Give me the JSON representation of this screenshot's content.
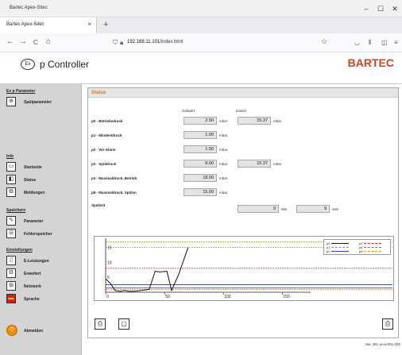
{
  "window": {
    "title": "Bartec Apex-Sitec"
  },
  "tab": {
    "label": "Bartec Apex-Sitec",
    "close": "×",
    "new": "+"
  },
  "nav": {
    "back": "←",
    "forward": "→",
    "reload": "C",
    "home": "⌂",
    "url_host": "192.168.11.101",
    "url_path": "/index.html"
  },
  "header": {
    "logo": "Ex",
    "title": "p Controller",
    "brand": "BARTEC"
  },
  "sidebar": {
    "sec_ex": "Ex p Parameter",
    "spuel": "Spülparameter",
    "sec_info": "Info",
    "startseite": "Startseite",
    "status": "Status",
    "meldungen": "Meldungen",
    "sec_speichern": "Speichern",
    "parameter": "Parameter",
    "fehlerspeicher": "Fehlerspeicher",
    "sec_einstellungen": "Einstellungen",
    "e_leistungen": "E-Leistungen",
    "erweitert": "Erweitert",
    "netzwerk": "Netzwerk",
    "sprache": "Sprache",
    "abmelden": "Abmelden"
  },
  "status": {
    "title": "Status",
    "col_soll": "Sollwert",
    "col_ist": "Istwert",
    "rows": [
      {
        "label": "p0 - Betriebsdruck",
        "soll": "2.50",
        "unit": "mbar",
        "ist": "15.37",
        "ist_unit": "mbar"
      },
      {
        "label": "p1 - Mindestdruck",
        "soll": "1.00",
        "unit": "mbar"
      },
      {
        "label": "p2 - Vor-Alarm",
        "soll": "1.50",
        "unit": "mbar"
      },
      {
        "label": "p3 - Spüldruck",
        "soll": "8.00",
        "unit": "mbar",
        "ist": "15.37",
        "ist_unit": "mbar"
      },
      {
        "label": "p4 - Maximaldruck, Betrieb",
        "soll": "18.00",
        "unit": "mbar"
      },
      {
        "label": "p5 - Maximaldruck, Spülen",
        "soll": "15.00",
        "unit": "mbar"
      }
    ],
    "spuelzeit_label": "Spülzeit",
    "spuelzeit_min": "0",
    "spuelzeit_min_unit": "Min",
    "spuelzeit_sek": "9",
    "spuelzeit_sek_unit": "Sek"
  },
  "chart_data": {
    "type": "line",
    "x_ticks": [
      "0",
      "50",
      "100",
      "150"
    ],
    "y_ticks": [
      "5",
      "10",
      "15"
    ],
    "xlim": [
      0,
      170
    ],
    "ylim": [
      0,
      17
    ],
    "legend": [
      "p0",
      "p1",
      "p2",
      "p3",
      "p4",
      "p5"
    ],
    "series_colors": {
      "p0": "#1a1a1a",
      "p1": "#e07a00",
      "p2": "#2b3fd6",
      "p3": "#cc2222",
      "p4": "#7a8f00",
      "p5": "#d4a500"
    },
    "pressure_line": {
      "x": [
        0,
        4,
        8,
        12,
        16,
        20,
        26,
        34,
        37,
        42,
        46,
        52,
        56,
        62,
        70
      ],
      "y": [
        4.5,
        3.0,
        0.6,
        0.3,
        0.6,
        0.3,
        0.4,
        0.8,
        1.0,
        7.0,
        6.8,
        7.0,
        0.6,
        6.0,
        15.0
      ]
    },
    "thresholds": {
      "p0": 2.5,
      "p1": 1.0,
      "p2": 1.5,
      "p3": 8.0,
      "p4": 18.0,
      "p5": 15.0
    }
  },
  "footer": {
    "version": "Hw. 451-ui-ui-001-000"
  },
  "icons": {
    "save": "save-icon",
    "open": "open-icon",
    "refresh": "refresh-icon"
  }
}
